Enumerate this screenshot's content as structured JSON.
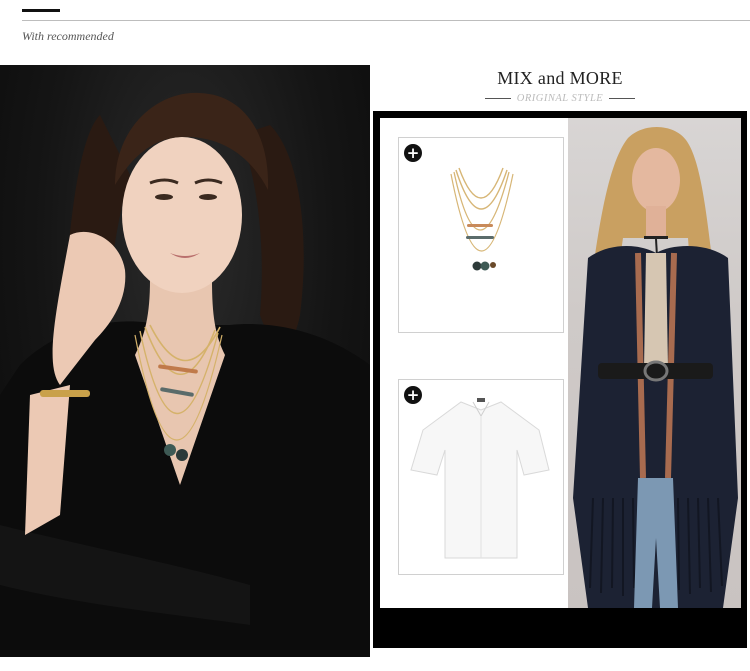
{
  "header": {
    "subtitle": "With recommended"
  },
  "feature": {
    "title": "MIX and MORE",
    "subtitle": "ORIGINAL STYLE"
  },
  "images": {
    "left_model": "model-wearing-layered-necklace",
    "necklace_product": "layered-gold-necklace-with-stones",
    "shirt_product": "white-oversized-shirt",
    "right_model": "model-in-fringe-cardigan"
  },
  "icons": {
    "add": "plus-circle-icon"
  },
  "colors": {
    "frame": "#000000",
    "accent": "#111111",
    "divider": "#bdbdbd",
    "subtitle_muted": "#bbbbbb"
  }
}
